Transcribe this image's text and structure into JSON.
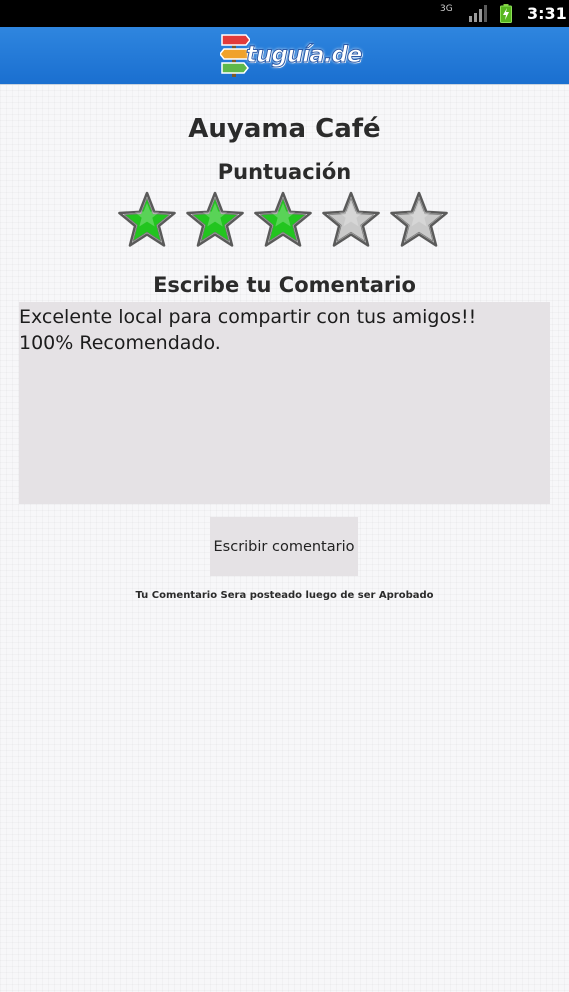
{
  "status_bar": {
    "network": "3G",
    "time": "3:31"
  },
  "header": {
    "logo_text": "tuguía",
    "logo_tld": ".de"
  },
  "place": {
    "name": "Auyama Café"
  },
  "rating": {
    "label": "Puntuación",
    "value": 3,
    "max": 5,
    "filled_color": "#22c51f",
    "empty_color": "#c9c9c9"
  },
  "comment": {
    "heading": "Escribe tu Comentario",
    "value": "Excelente local para compartir con tus amigos!!\n100% Recomendado."
  },
  "submit": {
    "label": "Escribir comentario"
  },
  "note": "Tu Comentario Sera posteado luego de ser Aprobado",
  "colors": {
    "app_bar": "#1e74d6",
    "status_bar": "#000000",
    "field_bg": "#e5e2e5"
  }
}
